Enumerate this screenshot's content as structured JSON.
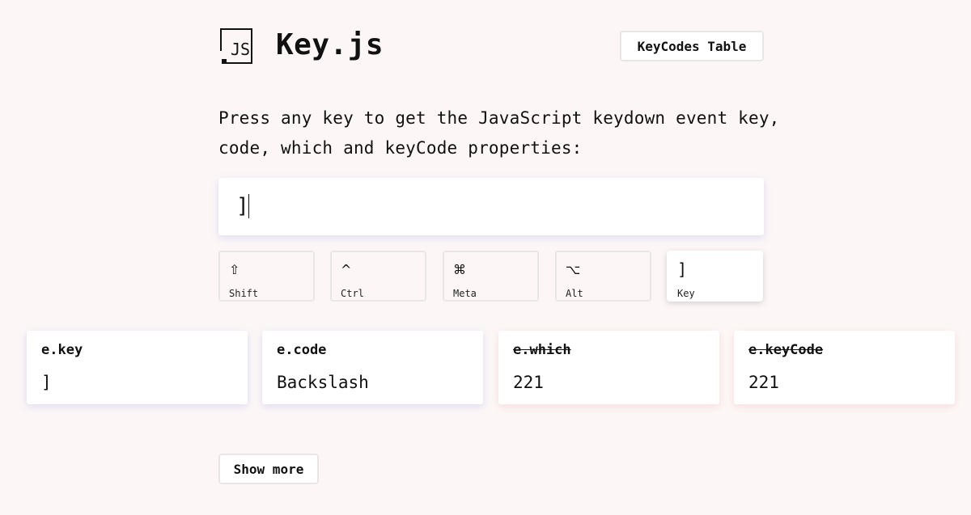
{
  "header": {
    "logo_icon": "js-file-icon",
    "title": "Key.js",
    "keycodes_button": "KeyCodes Table"
  },
  "intro": {
    "text": "Press any key to get the JavaScript keydown event key, code, which and keyCode properties:"
  },
  "key_input": {
    "value": "]"
  },
  "modifiers": [
    {
      "symbol": "⇧",
      "label": "Shift",
      "active": false
    },
    {
      "symbol": "^",
      "label": "Ctrl",
      "active": false
    },
    {
      "symbol": "⌘",
      "label": "Meta",
      "active": false
    },
    {
      "symbol": "⌥",
      "label": "Alt",
      "active": false
    },
    {
      "symbol": "]",
      "label": "Key",
      "active": true
    }
  ],
  "results": [
    {
      "label": "e.key",
      "value": "]",
      "deprecated": false
    },
    {
      "label": "e.code",
      "value": "Backslash",
      "deprecated": false
    },
    {
      "label": "e.which",
      "value": "221",
      "deprecated": true
    },
    {
      "label": "e.keyCode",
      "value": "221",
      "deprecated": true
    }
  ],
  "footer": {
    "show_more": "Show more"
  },
  "colors": {
    "background": "#fcf7f6",
    "card": "#ffffff",
    "border": "#e9e6e6",
    "text": "#111111"
  }
}
